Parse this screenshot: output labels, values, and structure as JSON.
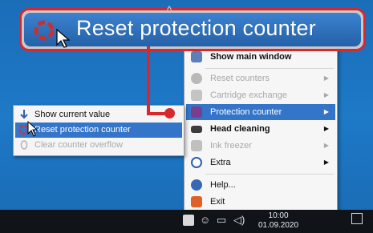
{
  "callout": {
    "title": "Reset protection counter",
    "icon": "reset-icon"
  },
  "main_menu": {
    "items": [
      {
        "label": "Show main window",
        "icon": "window-icon",
        "state": "normal",
        "bold": true,
        "submenu": false
      },
      {
        "label": "Reset counters",
        "icon": "reset-icon",
        "state": "disabled",
        "submenu": true
      },
      {
        "label": "Cartridge exchange",
        "icon": "cartridge-icon",
        "state": "disabled",
        "submenu": true
      },
      {
        "label": "Protection counter",
        "icon": "shield-icon",
        "state": "active",
        "submenu": true
      },
      {
        "label": "Head cleaning",
        "icon": "printhead-icon",
        "state": "normal",
        "bold": true,
        "submenu": true
      },
      {
        "label": "Ink freezer",
        "icon": "snowflake-icon",
        "state": "disabled",
        "submenu": true
      },
      {
        "label": "Extra",
        "icon": "extra-icon",
        "state": "normal",
        "submenu": true
      },
      {
        "label": "Help...",
        "icon": "help-icon",
        "state": "normal",
        "submenu": false
      },
      {
        "label": "Exit",
        "icon": "exit-icon",
        "state": "normal",
        "submenu": false
      }
    ]
  },
  "submenu": {
    "items": [
      {
        "label": "Show current value",
        "icon": "info-icon",
        "state": "normal"
      },
      {
        "label": "Reset protection counter",
        "icon": "reset-icon",
        "state": "active"
      },
      {
        "label": "Clear counter overflow",
        "icon": "zero-icon",
        "state": "disabled"
      }
    ]
  },
  "taskbar": {
    "clock_time": "10:00",
    "clock_date": "01.09.2020",
    "tray_icons": [
      "chevron-up-icon",
      "printer-tray-icon",
      "people-icon",
      "network-icon",
      "volume-icon",
      "notification-icon"
    ]
  },
  "colors": {
    "highlight": "#3475c9",
    "callout_border": "#d8272e",
    "callout_fill": "#2461a8",
    "taskbar": "#101418"
  }
}
